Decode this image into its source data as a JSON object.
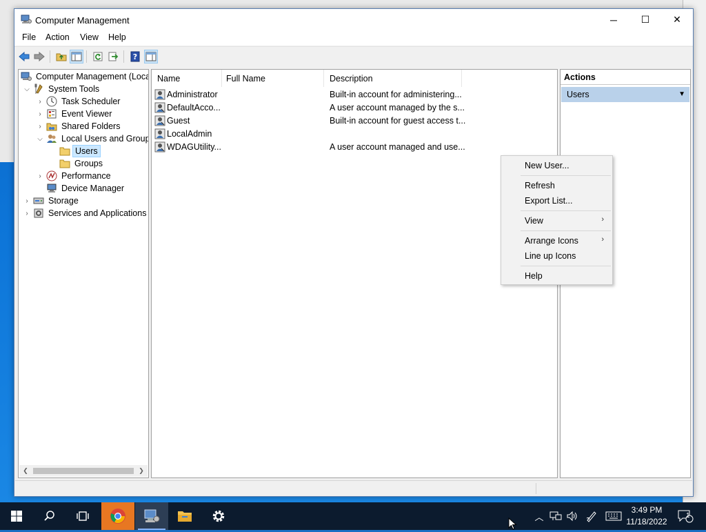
{
  "window": {
    "title": "Computer Management",
    "minimize_glyph": "─",
    "maximize_glyph": "☐",
    "close_glyph": "✕"
  },
  "menu": [
    "File",
    "Action",
    "View",
    "Help"
  ],
  "toolbar": {
    "icons": [
      "back-arrow-icon",
      "forward-arrow-icon",
      "up-folder-icon",
      "show-hide-console-tree-icon",
      "refresh-icon",
      "export-list-icon",
      "help-icon",
      "show-hide-action-pane-icon"
    ]
  },
  "tree": {
    "root": "Computer Management (Local",
    "system_tools": "System Tools",
    "task_scheduler": "Task Scheduler",
    "event_viewer": "Event Viewer",
    "shared_folders": "Shared Folders",
    "local_users_groups": "Local Users and Groups",
    "users": "Users",
    "groups": "Groups",
    "performance": "Performance",
    "device_manager": "Device Manager",
    "storage": "Storage",
    "services_apps": "Services and Applications"
  },
  "list": {
    "columns": [
      "Name",
      "Full Name",
      "Description"
    ],
    "rows": [
      {
        "name": "Administrator",
        "full_name": "",
        "description": "Built-in account for administering..."
      },
      {
        "name": "DefaultAcco...",
        "full_name": "",
        "description": "A user account managed by the s..."
      },
      {
        "name": "Guest",
        "full_name": "",
        "description": "Built-in account for guest access t..."
      },
      {
        "name": "LocalAdmin",
        "full_name": "",
        "description": ""
      },
      {
        "name": "WDAGUtility...",
        "full_name": "",
        "description": "A user account managed and use..."
      }
    ]
  },
  "actions": {
    "header": "Actions",
    "section": "Users"
  },
  "context_menu": {
    "new_user": "New User...",
    "refresh": "Refresh",
    "export_list": "Export List...",
    "view": "View",
    "arrange_icons": "Arrange Icons",
    "line_up_icons": "Line up Icons",
    "help": "Help"
  },
  "taskbar": {
    "time": "3:49 PM",
    "date": "11/18/2022",
    "notification_count": "1"
  },
  "colors": {
    "selection": "#cce8ff",
    "actions_section_bg": "#b9d1ea",
    "taskbar_bg": "#0c1b2e",
    "desktop_blue": "#0d75d8"
  }
}
